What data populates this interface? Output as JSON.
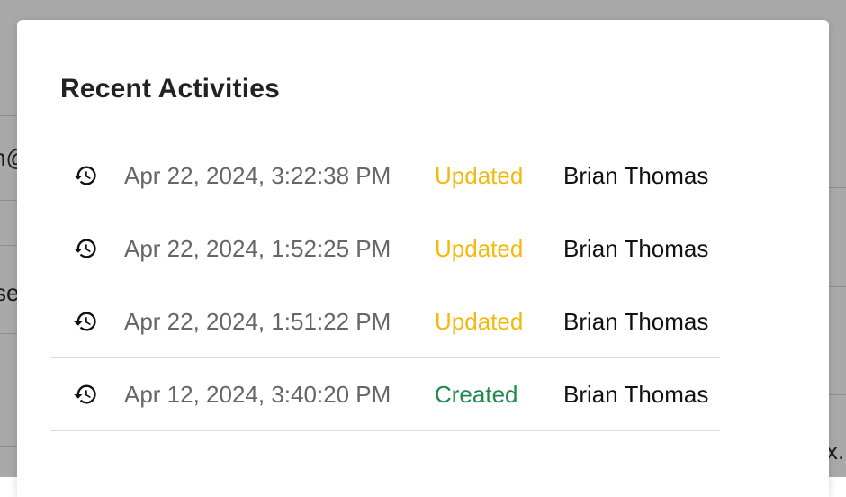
{
  "modal": {
    "title": "Recent Activities"
  },
  "background": {
    "fragments": [
      "n@",
      "se",
      "x."
    ]
  },
  "colors": {
    "updated": "#f2b90f",
    "created": "#1f8a4c"
  },
  "activities": [
    {
      "icon": "history-icon",
      "timestamp": "Apr 22, 2024, 3:22:38 PM",
      "action": "Updated",
      "action_type": "updated",
      "user": "Brian Thomas"
    },
    {
      "icon": "history-icon",
      "timestamp": "Apr 22, 2024, 1:52:25 PM",
      "action": "Updated",
      "action_type": "updated",
      "user": "Brian Thomas"
    },
    {
      "icon": "history-icon",
      "timestamp": "Apr 22, 2024, 1:51:22 PM",
      "action": "Updated",
      "action_type": "updated",
      "user": "Brian Thomas"
    },
    {
      "icon": "history-icon",
      "timestamp": "Apr 12, 2024, 3:40:20 PM",
      "action": "Created",
      "action_type": "created",
      "user": "Brian Thomas"
    }
  ]
}
